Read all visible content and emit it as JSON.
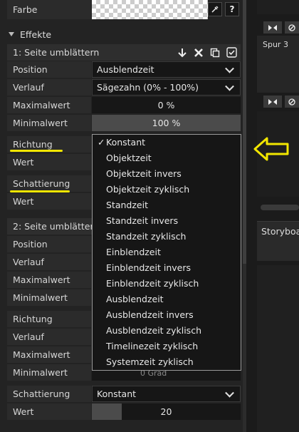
{
  "farbe": {
    "label": "Farbe",
    "pick_icon": "eyedropper-icon",
    "help_label": "?"
  },
  "effekte": {
    "label": "Effekte"
  },
  "effect1": {
    "title": "1: Seite umblättern",
    "buttons": [
      "move-down-icon",
      "delete-icon",
      "copy-icon",
      "checkbox-icon"
    ],
    "rows": [
      {
        "label": "Position",
        "value": "Ausblendzeit"
      },
      {
        "label": "Verlauf",
        "value": "Sägezahn (0% - 100%)"
      },
      {
        "label": "Maximalwert",
        "value": "0 %"
      },
      {
        "label": "Minimalwert",
        "value": "100 %"
      }
    ],
    "richtung_label": "Richtung",
    "wert_label": "Wert",
    "schattierung_label": "Schattierung",
    "wert2_label": "Wert"
  },
  "effect2": {
    "title": "2: Seite umblättern",
    "rows": [
      {
        "label": "Position"
      },
      {
        "label": "Verlauf"
      },
      {
        "label": "Maximalwert"
      },
      {
        "label": "Minimalwert"
      }
    ],
    "richtung_label": "Richtung",
    "verlauf2_label": "Verlauf",
    "maximal2_label": "Maximalwert",
    "minimal2_label": "Minimalwert",
    "minimal2_value": "0 Grad",
    "schattierung_label": "Schattierung",
    "schattierung_value": "Konstant",
    "wert_label": "Wert",
    "wert_value": "20"
  },
  "dropdown": {
    "check": "✓",
    "selected": "Konstant",
    "options": [
      "Objektzeit",
      "Objektzeit invers",
      "Objektzeit zyklisch",
      "Standzeit",
      "Standzeit invers",
      "Standzeit zyklisch",
      "Einblendzeit",
      "Einblendzeit invers",
      "Einblendzeit zyklisch",
      "Ausblendzeit",
      "Ausblendzeit invers",
      "Ausblendzeit zyklisch",
      "Timelinezeit zyklisch",
      "Systemzeit zyklisch"
    ]
  },
  "right": {
    "track_label": "Spur 3",
    "storyboard_label": "Storyboa"
  },
  "colors": {
    "highlight": "#f2e600",
    "panel": "#232323",
    "field": "#171717"
  }
}
